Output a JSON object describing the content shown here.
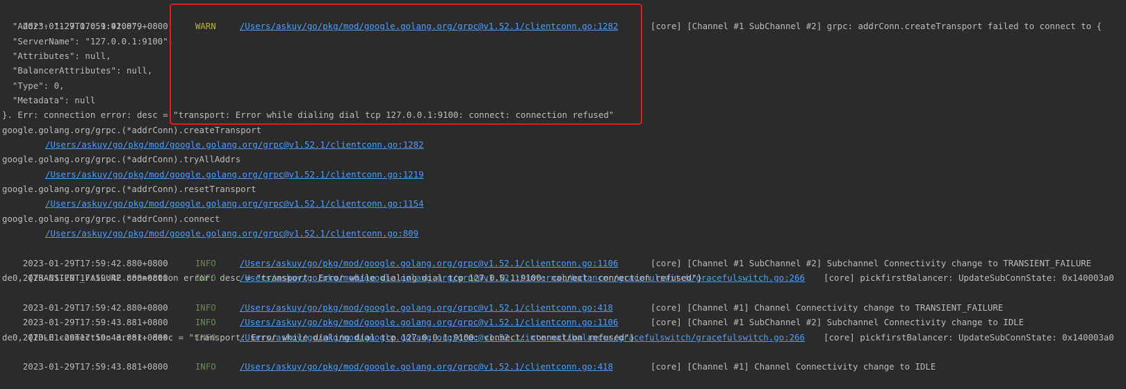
{
  "console": {
    "l01": {
      "ts": "2023-01-29T17:59:42.879+0800",
      "level": "WARN",
      "link": "/Users/askuy/go/pkg/mod/google.golang.org/grpc@v1.52.1/clientconn.go:1282",
      "msg": "[core] [Channel #1 SubChannel #2] grpc: addrConn.createTransport failed to connect to {"
    },
    "l02": "  \"Addr\": \"127.0.0.1:9100\",",
    "l03": "  \"ServerName\": \"127.0.0.1:9100\",",
    "l04": "  \"Attributes\": null,",
    "l05": "  \"BalancerAttributes\": null,",
    "l06": "  \"Type\": 0,",
    "l07": "  \"Metadata\": null",
    "l08": "}. Err: connection error: desc = \"transport: Error while dialing dial tcp 127.0.0.1:9100: connect: connection refused\"",
    "l09": "google.golang.org/grpc.(*addrConn).createTransport",
    "l10": "/Users/askuy/go/pkg/mod/google.golang.org/grpc@v1.52.1/clientconn.go:1282",
    "l11": "google.golang.org/grpc.(*addrConn).tryAllAddrs",
    "l12": "/Users/askuy/go/pkg/mod/google.golang.org/grpc@v1.52.1/clientconn.go:1219",
    "l13": "google.golang.org/grpc.(*addrConn).resetTransport",
    "l14": "/Users/askuy/go/pkg/mod/google.golang.org/grpc@v1.52.1/clientconn.go:1154",
    "l15": "google.golang.org/grpc.(*addrConn).connect",
    "l16": "/Users/askuy/go/pkg/mod/google.golang.org/grpc@v1.52.1/clientconn.go:809",
    "l17": {
      "ts": "2023-01-29T17:59:42.880+0800",
      "level": "INFO",
      "link": "/Users/askuy/go/pkg/mod/google.golang.org/grpc@v1.52.1/clientconn.go:1106",
      "msg": "[core] [Channel #1 SubChannel #2] Subchannel Connectivity change to TRANSIENT_FAILURE"
    },
    "l18": {
      "ts": "2023-01-29T17:59:42.880+0800",
      "level": "INFO",
      "link": "/Users/askuy/go/pkg/mod/google.golang.org/grpc@v1.52.1/internal/balancer/gracefulswitch/gracefulswitch.go:266",
      "msg": "[core] pickfirstBalancer: UpdateSubConnState: 0x140003a0"
    },
    "l19": "de0, {TRANSIENT_FAILURE connection error: desc = \"transport: Error while dialing dial tcp 127.0.0.1:9100: connect: connection refused\"}",
    "l20": {
      "ts": "2023-01-29T17:59:42.880+0800",
      "level": "INFO",
      "link": "/Users/askuy/go/pkg/mod/google.golang.org/grpc@v1.52.1/clientconn.go:418",
      "msg": "[core] [Channel #1] Channel Connectivity change to TRANSIENT_FAILURE"
    },
    "l21": {
      "ts": "2023-01-29T17:59:43.881+0800",
      "level": "INFO",
      "link": "/Users/askuy/go/pkg/mod/google.golang.org/grpc@v1.52.1/clientconn.go:1106",
      "msg": "[core] [Channel #1 SubChannel #2] Subchannel Connectivity change to IDLE"
    },
    "l22": {
      "ts": "2023-01-29T17:59:43.881+0800",
      "level": "INFO",
      "link": "/Users/askuy/go/pkg/mod/google.golang.org/grpc@v1.52.1/internal/balancer/gracefulswitch/gracefulswitch.go:266",
      "msg": "[core] pickfirstBalancer: UpdateSubConnState: 0x140003a0"
    },
    "l23": "de0, {IDLE connection error: desc = \"transport: Error while dialing dial tcp 127.0.0.1:9100: connect: connection refused\"}",
    "l24": {
      "ts": "2023-01-29T17:59:43.881+0800",
      "level": "INFO",
      "link": "/Users/askuy/go/pkg/mod/google.golang.org/grpc@v1.52.1/clientconn.go:418",
      "msg": "[core] [Channel #1] Channel Connectivity change to IDLE"
    }
  },
  "colors": {
    "background": "#2b2b2b",
    "text": "#bbbbbb",
    "warn": "#bbb529",
    "info": "#6a8759",
    "link": "#4a9eff",
    "highlight": "#e8191d"
  }
}
